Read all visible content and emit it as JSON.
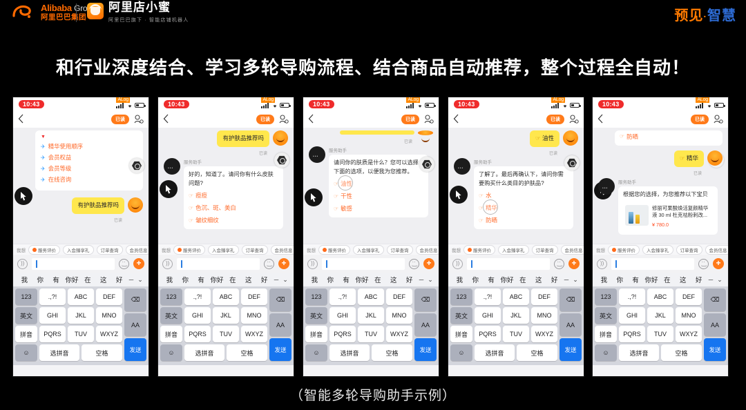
{
  "header": {
    "alibaba_en_bold": "Alibaba",
    "alibaba_en_light": "Group",
    "alibaba_cn": "阿里巴巴集团",
    "product_title": "阿里店小蜜",
    "product_sub": "阿里巴巴旗下 · 智能店铺机器人",
    "corner_orange": "预见",
    "corner_dot": "·",
    "corner_blue": "智慧"
  },
  "headline": "和行业深度结合、学习多轮导购流程、结合商品自动推荐，整个过程全自动！",
  "caption": "（智能多轮导购助手示例）",
  "phone_common": {
    "time": "10:43",
    "alog_badge": "ALog",
    "nav_pill": "已读",
    "bot_name": "服务助手",
    "read_tag": "已读",
    "quick_label": "我想",
    "chips": [
      "服务评价",
      "入会臻享礼",
      "订单查询",
      "会员信息"
    ],
    "input_placeholder": ""
  },
  "keyboard": {
    "suggestions": [
      "我",
      "你",
      "有",
      "你好",
      "在",
      "这",
      "好"
    ],
    "minus": "－",
    "chevron": "⌄",
    "rows": [
      [
        "123",
        ".,?!",
        "ABC",
        "DEF",
        "⌫"
      ],
      [
        "英文",
        "GHI",
        "JKL",
        "MNO",
        "AA"
      ],
      [
        "拼音",
        "PQRS",
        "TUV",
        "WXYZ",
        "发送"
      ],
      [
        "☺",
        "选拼音",
        "空格"
      ]
    ],
    "send_label": "发送"
  },
  "phones": [
    {
      "id": "phone-1",
      "menu_items": [
        "精华使用顺序",
        "会员权益",
        "会员等级",
        "在线咨询"
      ],
      "user_message": "有护肤品推荐吗"
    },
    {
      "id": "phone-2",
      "user_message": "有护肤品推荐吗",
      "bot_text": "好的，知道了。请问你有什么皮肤问题?",
      "options": [
        "痘痘",
        "色沉、斑、美白",
        "皱纹细纹"
      ]
    },
    {
      "id": "phone-3",
      "bot_text": "请问你的肤质是什么？您可以选择下面的选项，以便我为您推荐。",
      "options": [
        "油性",
        "干性",
        "敏感"
      ],
      "tapped_option": "油性"
    },
    {
      "id": "phone-4",
      "user_message": "油性",
      "bot_text": "了解了。最后再确认下，请问你需要购买什么类目的护肤品?",
      "options": [
        "水",
        "精华",
        "防晒"
      ],
      "tapped_option": "精华"
    },
    {
      "id": "phone-5",
      "prev_option": "防晒",
      "user_message": "精华",
      "bot_text": "根据您的选择，为您推荐以下宝贝",
      "product": {
        "name": "修丽可果酸焕活复颜精华液 30 ml 杜克祛粉刺改...",
        "price": "¥ 780.0"
      }
    }
  ],
  "colors": {
    "brand_orange": "#ff6a00",
    "accent_blue": "#2d6bd4",
    "bubble_yellow": "#ffe74d",
    "option_orange": "#ff6a2a",
    "send_blue": "#1675f0"
  }
}
